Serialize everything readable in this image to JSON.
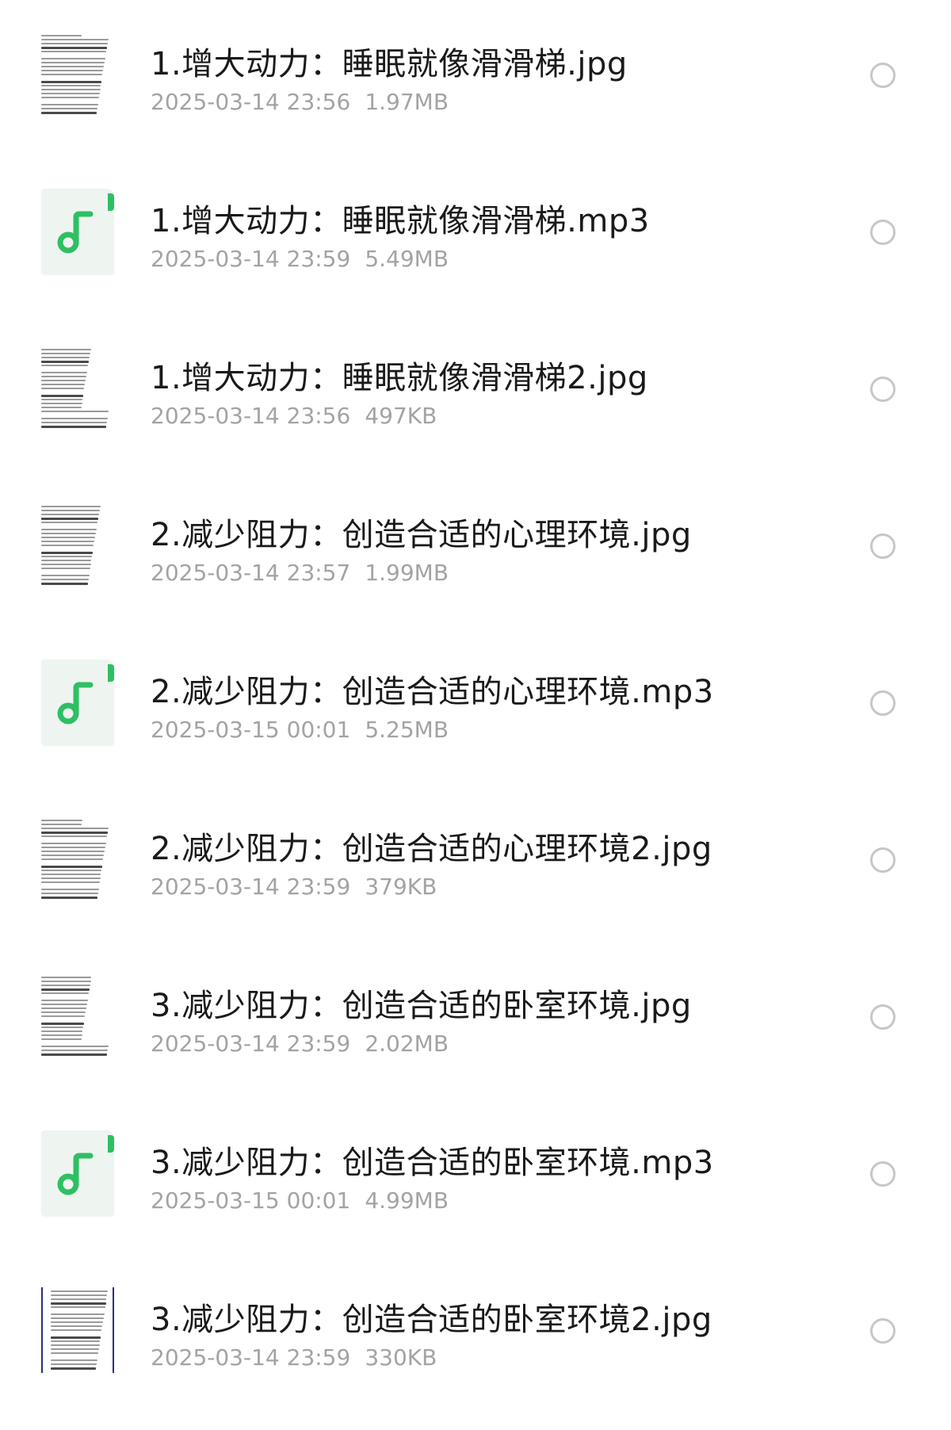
{
  "files": [
    {
      "name": "1.增大动力：睡眠就像滑滑梯.jpg",
      "date": "2025-03-14 23:56",
      "size": "1.97MB",
      "type": "image"
    },
    {
      "name": "1.增大动力：睡眠就像滑滑梯.mp3",
      "date": "2025-03-14 23:59",
      "size": "5.49MB",
      "type": "audio",
      "icon": "music-note-icon",
      "accent": "#2fbf63"
    },
    {
      "name": "1.增大动力：睡眠就像滑滑梯2.jpg",
      "date": "2025-03-14 23:56",
      "size": "497KB",
      "type": "image"
    },
    {
      "name": "2.减少阻力：创造合适的心理环境.jpg",
      "date": "2025-03-14 23:57",
      "size": "1.99MB",
      "type": "image"
    },
    {
      "name": "2.减少阻力：创造合适的心理环境.mp3",
      "date": "2025-03-15 00:01",
      "size": "5.25MB",
      "type": "audio",
      "icon": "music-note-icon",
      "accent": "#2fbf63"
    },
    {
      "name": "2.减少阻力：创造合适的心理环境2.jpg",
      "date": "2025-03-14 23:59",
      "size": "379KB",
      "type": "image"
    },
    {
      "name": "3.减少阻力：创造合适的卧室环境.jpg",
      "date": "2025-03-14 23:59",
      "size": "2.02MB",
      "type": "image"
    },
    {
      "name": "3.减少阻力：创造合适的卧室环境.mp3",
      "date": "2025-03-15 00:01",
      "size": "4.99MB",
      "type": "audio",
      "icon": "music-note-icon",
      "accent": "#2fbf63"
    },
    {
      "name": "3.减少阻力：创造合适的卧室环境2.jpg",
      "date": "2025-03-14 23:59",
      "size": "330KB",
      "type": "image"
    }
  ]
}
